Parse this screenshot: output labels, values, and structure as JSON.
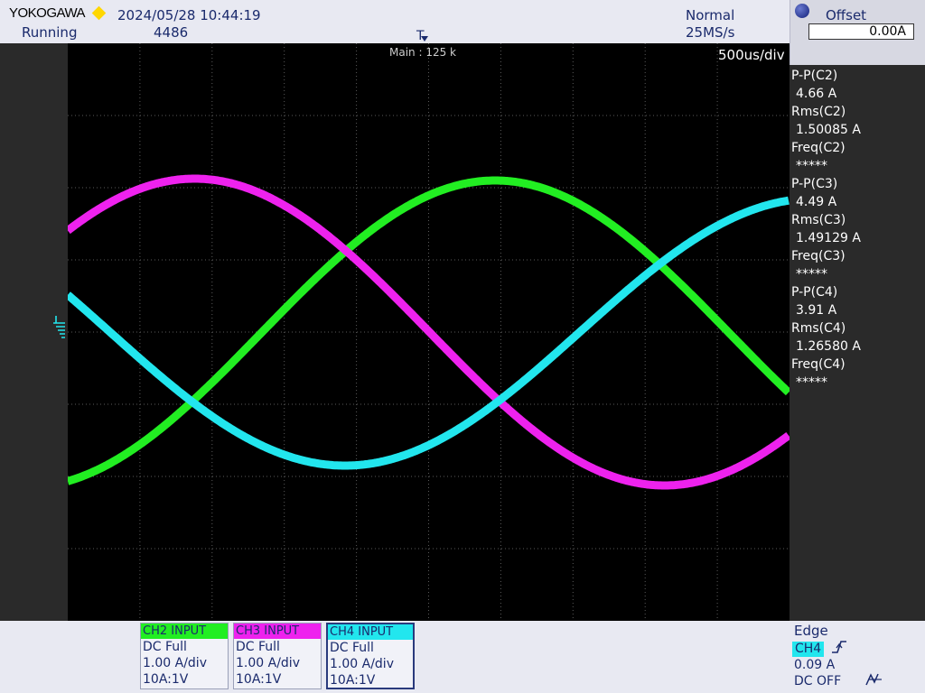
{
  "header": {
    "brand": "YOKOGAWA",
    "datetime": "2024/05/28 10:44:19",
    "run_state": "Running",
    "acq_count": "4486",
    "trigger_mode": "Normal",
    "sample_rate": "25MS/s",
    "main_label": "Main : 125 k",
    "timebase": "500us/div"
  },
  "offset": {
    "label": "Offset",
    "value": "0.00A"
  },
  "measurements": [
    {
      "name": "P-P(C2)",
      "value": "4.66 A"
    },
    {
      "name": "Rms(C2)",
      "value": "1.50085 A"
    },
    {
      "name": "Freq(C2)",
      "value": "*****"
    },
    {
      "name": "P-P(C3)",
      "value": "4.49 A"
    },
    {
      "name": "Rms(C3)",
      "value": "1.49129 A"
    },
    {
      "name": "Freq(C3)",
      "value": "*****"
    },
    {
      "name": "P-P(C4)",
      "value": "3.91 A"
    },
    {
      "name": "Rms(C4)",
      "value": "1.26580 A"
    },
    {
      "name": "Freq(C4)",
      "value": "*****"
    }
  ],
  "channels": [
    {
      "title": "CH2  INPUT",
      "coupling": "DC Full",
      "scale": "1.00 A/div",
      "probe": "10A:1V",
      "color": "#22ee22"
    },
    {
      "title": "CH3  INPUT",
      "coupling": "DC Full",
      "scale": "1.00 A/div",
      "probe": "10A:1V",
      "color": "#ee22ee"
    },
    {
      "title": "CH4  INPUT",
      "coupling": "DC Full",
      "scale": "1.00 A/div",
      "probe": "10A:1V",
      "color": "#22e6ee"
    }
  ],
  "trigger": {
    "type": "Edge",
    "source": "CH4",
    "level": "0.09 A",
    "coupling": "DC OFF"
  },
  "colors": {
    "ch2": "#22ee22",
    "ch3": "#ee22ee",
    "ch4": "#22e6ee",
    "accent": "#ffd700"
  }
}
